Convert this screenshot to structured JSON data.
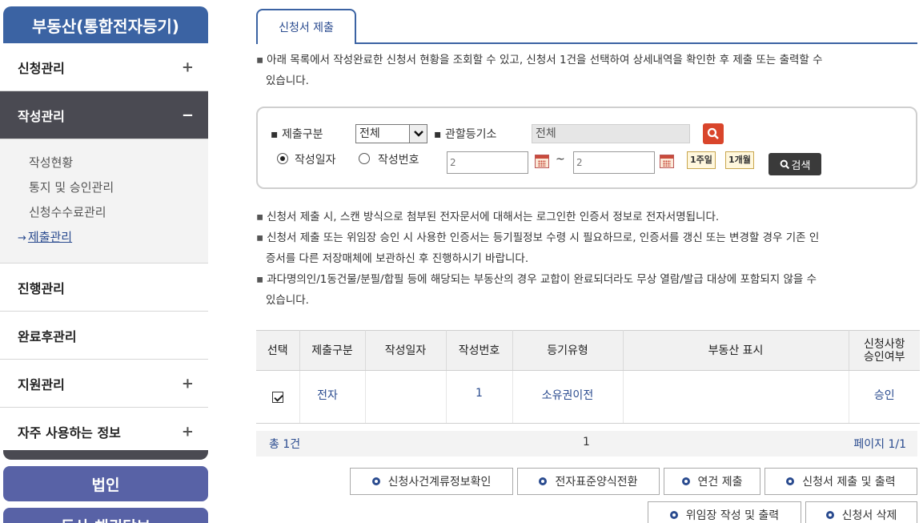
{
  "sidebar": {
    "title": "부동산(통합전자등기)",
    "items": [
      {
        "label": "신청관리",
        "sign": "+"
      },
      {
        "label": "작성관리",
        "sign": "−"
      },
      {
        "label": "진행관리",
        "sign": ""
      },
      {
        "label": "완료후관리",
        "sign": ""
      },
      {
        "label": "지원관리",
        "sign": "+"
      },
      {
        "label": "자주 사용하는 정보",
        "sign": "+"
      }
    ],
    "sub_items": [
      "작성현황",
      "통지 및 승인관리",
      "신청수수료관리",
      "제출관리"
    ],
    "current_arrow": "→",
    "btn_corp": "법인",
    "btn_next": "동산·채권담보"
  },
  "main": {
    "tab": "신청서 제출",
    "notice_top_1": "아래 목록에서 작성완료한 신청서 현황을 조회할 수 있고, 신청서 1건을 선택하여 상세내역을 확인한 후 제출 또는 출력할 수",
    "notice_top_2": "있습니다.",
    "notes": [
      "신청서 제출 시, 스캔 방식으로 첨부된 전자문서에 대해서는 로그인한 인증서 정보로 전자서명됩니다.",
      "신청서 제출 또는 위임장 승인 시 사용한 인증서는 등기필정보 수령 시 필요하므로, 인증서를 갱신 또는 변경할 경우 기존 인",
      "증서를 다른 저장매체에 보관하신 후 진행하시기 바랍니다.",
      "과다명의인/1동건물/분필/합필 등에 해당되는 부동산의 경우 교합이 완료되더라도 무상 열람/발급 대상에 포함되지 않을 수",
      "있습니다."
    ],
    "bullet": "▪"
  },
  "search": {
    "submit_type_label": "제출구분",
    "submit_type_value": "전체",
    "office_label": "관할등기소",
    "office_value": "전체",
    "radio_date": "작성일자",
    "radio_number": "작성번호",
    "date_from": "2",
    "date_to": "2",
    "tilde": "~",
    "week": "1주일",
    "month": "1개월",
    "search_btn": "검색"
  },
  "table": {
    "headers": [
      "선택",
      "제출구분",
      "작성일자",
      "작성번호",
      "등기유형",
      "부동산 표시",
      "신청사항\n승인여부"
    ],
    "rows": [
      {
        "type": "전자",
        "date": "",
        "number": "1",
        "reg_type": "소유권이전",
        "property": "",
        "approval": "승인"
      }
    ]
  },
  "summary": {
    "total": "총 1건",
    "page": "1",
    "page_info": "페이지 1/1"
  },
  "actions": {
    "row1": [
      "신청사건계류정보확인",
      "전자표준양식전환",
      "연건 제출",
      "신청서 제출 및 출력"
    ],
    "row2": [
      "위임장 작성 및 출력",
      "신청서 삭제"
    ]
  }
}
